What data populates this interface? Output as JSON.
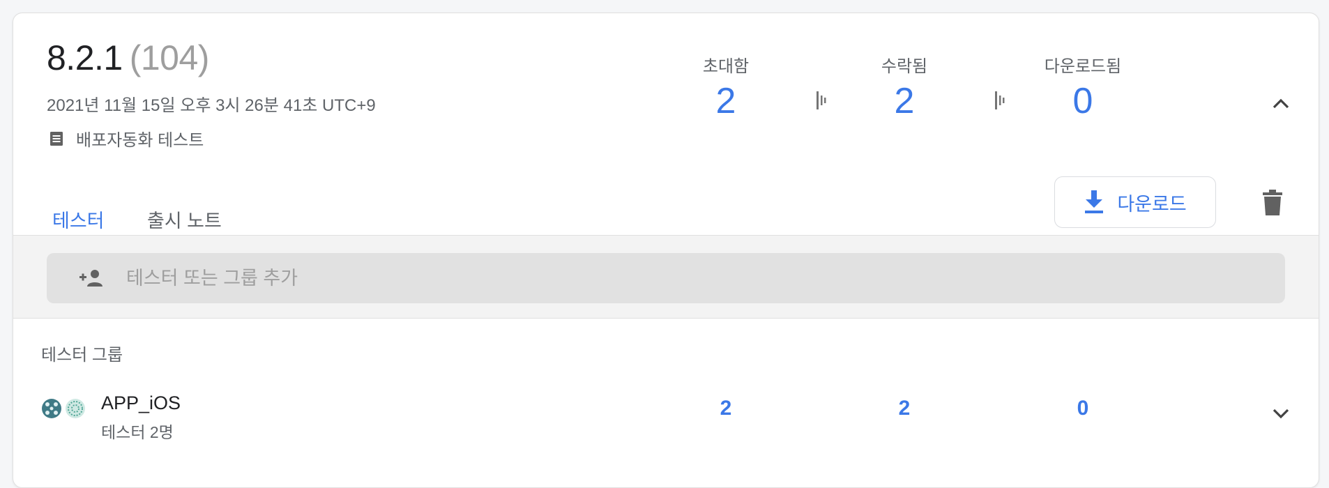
{
  "release": {
    "version": "8.2.1",
    "build": "(104)",
    "date": "2021년 11월 15일 오후 3시 26분 41초 UTC+9",
    "note": "배포자동화 테스트"
  },
  "stats": [
    {
      "label": "초대함",
      "value": "2"
    },
    {
      "label": "수락됨",
      "value": "2"
    },
    {
      "label": "다운로드됨",
      "value": "0"
    }
  ],
  "tabs": [
    {
      "label": "테스터",
      "active": true
    },
    {
      "label": "출시 노트",
      "active": false
    }
  ],
  "actions": {
    "download_label": "다운로드"
  },
  "add_tester": {
    "placeholder": "테스터 또는 그룹 추가",
    "value": ""
  },
  "groups": {
    "title": "테스터 그룹",
    "items": [
      {
        "name": "APP_iOS",
        "subtitle": "테스터 2명",
        "invited": "2",
        "accepted": "2",
        "downloaded": "0"
      }
    ]
  },
  "colors": {
    "accent": "#3b78e7",
    "muted": "#5f6368",
    "band": "#f3f3f3",
    "input": "#e1e1e1"
  },
  "icons": [
    "note-icon",
    "bar-separator-icon",
    "chevron-up-icon",
    "download-icon",
    "trash-icon",
    "person-add-icon",
    "group-avatar-icon",
    "chevron-down-icon"
  ]
}
